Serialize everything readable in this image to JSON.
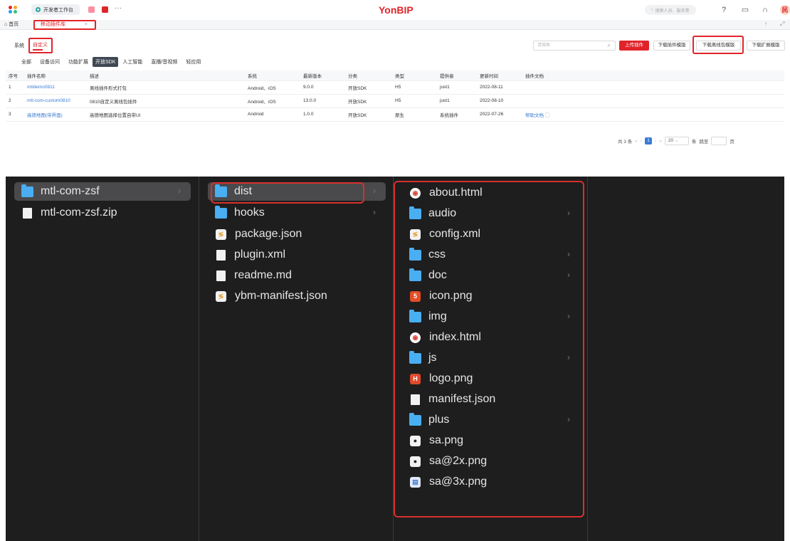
{
  "header": {
    "workspace_tab": "开发者工作台",
    "more": "···",
    "brand": "YonBIP",
    "search_placeholder": "搜索人员、服务等",
    "avatar_text": "民"
  },
  "tabs": {
    "home": "首页",
    "active": "移动插件库",
    "close": "×"
  },
  "filters": {
    "system_label": "系统",
    "custom_label": "自定义",
    "categories": [
      "全部",
      "设备访问",
      "功能扩展",
      "开放SDK",
      "人工智能",
      "直播/音视频",
      "轻应用"
    ],
    "active_category": "开放SDK"
  },
  "toolbar": {
    "search_placeholder": "请搜索",
    "upload": "上传插件",
    "download_plugin_template": "下载插件模版",
    "download_offline_template": "下载离线包模版",
    "download_ext_template": "下载扩展模版"
  },
  "table": {
    "headers": [
      "序号",
      "插件名称",
      "描述",
      "系统",
      "最新版本",
      "分类",
      "类型",
      "提供者",
      "更新时间",
      "插件文档"
    ],
    "rows": [
      [
        "1",
        "mtldemo0811",
        "离线插件形式打包",
        "Android、iOS",
        "9.0.0",
        "开放SDK",
        "H5",
        "just1",
        "2022-08-11",
        ""
      ],
      [
        "2",
        "mtl-com-custom0810",
        "0810自定义离线包插件",
        "Android、iOS",
        "13.0.0",
        "开放SDK",
        "H5",
        "just1",
        "2022-08-10",
        ""
      ],
      [
        "3",
        "高德地图(带界面)",
        "高德地图选择位置自带UI",
        "Android",
        "1.0.0",
        "开放SDK",
        "原生",
        "系统插件",
        "2022-07-26",
        "帮助文档"
      ]
    ]
  },
  "pager": {
    "total": "共 3 条",
    "page": "1",
    "size": "20",
    "unit": "条",
    "jump": "跳至",
    "page_suffix": "页"
  },
  "finder": {
    "col1": [
      "mtl-com-zsf",
      "mtl-com-zsf.zip"
    ],
    "col2": [
      "dist",
      "hooks",
      "package.json",
      "plugin.xml",
      "readme.md",
      "ybm-manifest.json"
    ],
    "col3": [
      "about.html",
      "audio",
      "config.xml",
      "css",
      "doc",
      "icon.png",
      "img",
      "index.html",
      "js",
      "logo.png",
      "manifest.json",
      "plus",
      "sa.png",
      "sa@2x.png",
      "sa@3x.png"
    ]
  }
}
